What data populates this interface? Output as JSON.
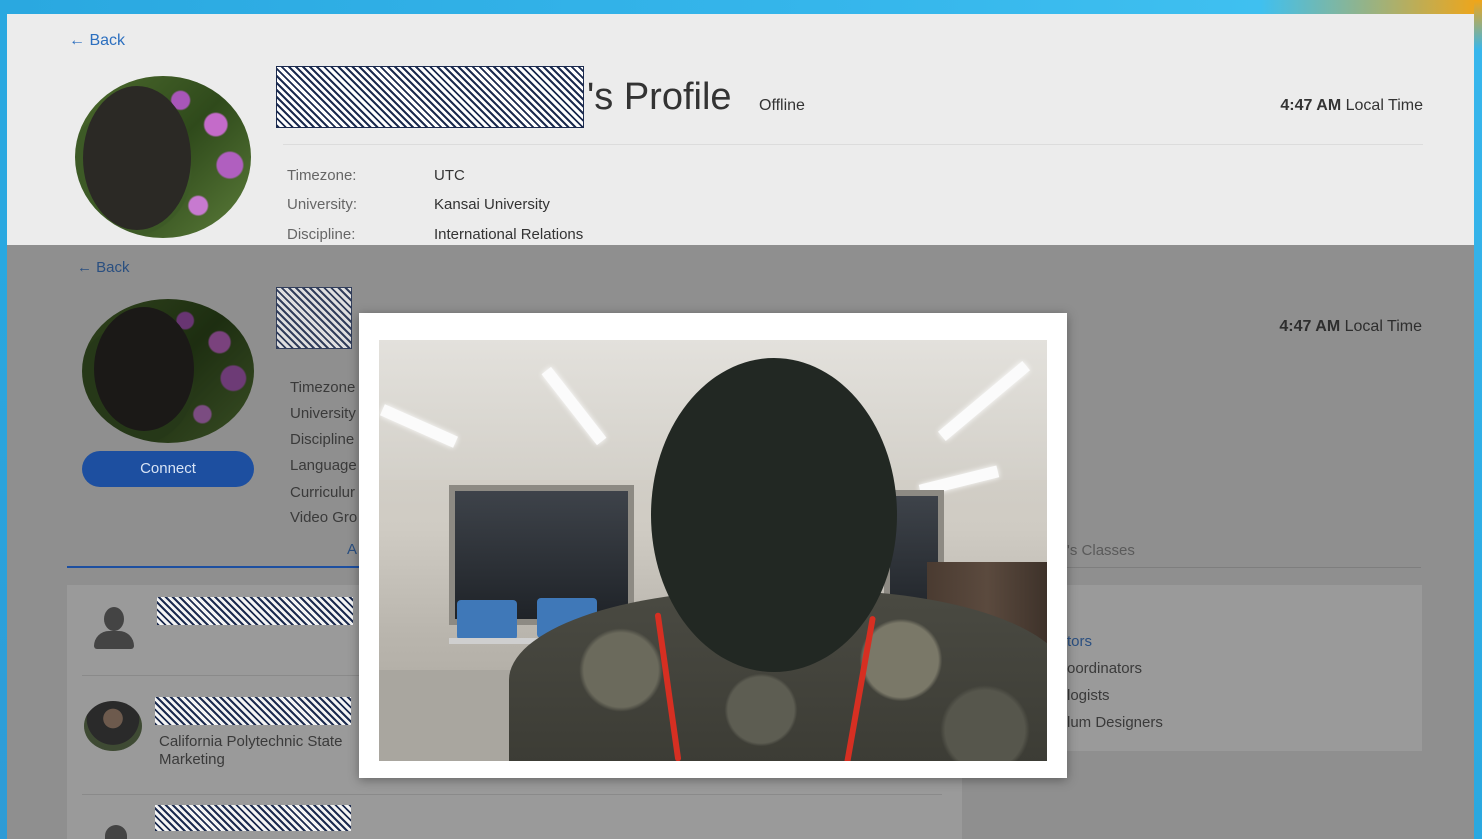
{
  "top_panel": {
    "back_label": "← Back",
    "title_suffix": "'s Profile",
    "status": "Offline",
    "local_time_value": "4:47 AM",
    "local_time_label": "Local Time",
    "fields": [
      {
        "label": "Timezone:",
        "value": "UTC"
      },
      {
        "label": "University:",
        "value": "Kansai University"
      },
      {
        "label": "Discipline:",
        "value": "International Relations"
      }
    ]
  },
  "background_page": {
    "back_label": "← Back",
    "local_time_value": "4:47 AM",
    "local_time_label": "Local Time",
    "connect_label": "Connect",
    "field_labels": [
      "Timezone",
      "University",
      "Discipline",
      "Language",
      "Curriculur",
      "Video Gro"
    ],
    "tab_partial_left": "A",
    "tab_partial_right": "'s Classes",
    "right_list": [
      "tors",
      "oordinators",
      "logists",
      "lum Designers"
    ],
    "list_entries": [
      {
        "sub1": "",
        "sub2": ""
      },
      {
        "sub1": "California Polytechnic State",
        "sub2": "Marketing"
      }
    ]
  },
  "colors": {
    "accent_blue": "#1d4fa0",
    "link_blue": "#2c6fbf",
    "top_bar": "#2aa8e0"
  }
}
